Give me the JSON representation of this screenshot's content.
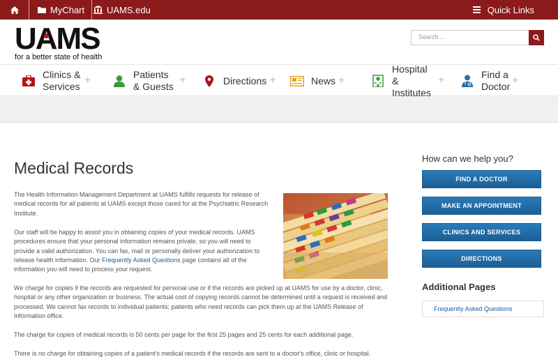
{
  "topbar": {
    "mychart_label": "MyChart",
    "uams_edu_label": "UAMS.edu",
    "quick_links_label": "Quick Links"
  },
  "header": {
    "logo_text": "UAMS",
    "tagline": "for a better state of health",
    "search_placeholder": "Search ..."
  },
  "nav": {
    "items": [
      {
        "label": "Clinics & Services",
        "icon": "first-aid-icon"
      },
      {
        "label": "Patients & Guests",
        "icon": "person-icon"
      },
      {
        "label": "Directions",
        "icon": "map-pin-icon"
      },
      {
        "label": "News",
        "icon": "newspaper-icon"
      },
      {
        "label": "Hospital & Institutes",
        "icon": "hospital-icon"
      },
      {
        "label": "Find a Doctor",
        "icon": "doctor-icon"
      }
    ]
  },
  "main": {
    "title": "Medical Records",
    "p1": "The Health Information Management Department at UAMS fulfills requests for release of medical records for all patients at UAMS except those cared for at the Psychiatric Research Institute.",
    "p2_before": "Our staff will be happy to assist you in obtaining copies of your medical records. UAMS procedures ensure that your personal information remains private, so you will need to provide a valid authorization. You can fax, mail or personally deliver your authorization to release health information. Our ",
    "p2_link": "Frequently Asked Questions",
    "p2_after": " page contains all of the information you will need to process your request.",
    "p3": "We charge for copies if the records are requested for personal use or if the records are picked up at UAMS for use by a doctor, clinic, hospital or any other organization or business. The actual cost of copying records cannot be determined until a request is received and processed. We cannot fax records to individual patients; patients who need records can pick them up at the UAMS Release of Information office.",
    "p4": "The charge for copies of medical records is 50 cents per page for the first 25 pages and 25 cents for each additional page.",
    "p5": "There is no charge for obtaining copies of a patient's medical records if the records are sent to a doctor's office, clinic or hospital."
  },
  "sidebar": {
    "title": "How can we help you?",
    "buttons": [
      "FIND A DOCTOR",
      "MAKE AN APPOINTMENT",
      "CLINICS AND SERVICES",
      "DIRECTIONS"
    ],
    "additional_title": "Additional Pages",
    "faq_link": "Frequently Asked Questions"
  },
  "colors": {
    "brand_red": "#8b1a1a",
    "button_blue": "#1c5f96",
    "link_blue": "#1a5c9c"
  }
}
